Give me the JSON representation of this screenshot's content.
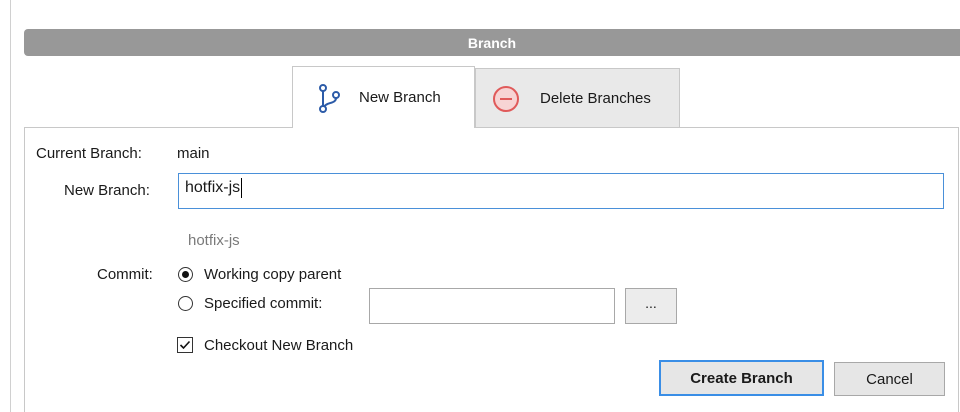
{
  "dialog": {
    "title": "Branch"
  },
  "tabs": [
    {
      "label": "New Branch",
      "icon": "branch-icon",
      "active": true
    },
    {
      "label": "Delete Branches",
      "icon": "minus-circle-icon",
      "active": false
    }
  ],
  "form": {
    "current_branch_label": "Current Branch:",
    "current_branch_value": "main",
    "new_branch_label": "New Branch:",
    "new_branch_value": "hotfix-js",
    "branch_preview": "hotfix-js",
    "commit_label": "Commit:",
    "commit_options": [
      {
        "label": "Working copy parent",
        "checked": true
      },
      {
        "label": "Specified commit:",
        "checked": false
      }
    ],
    "specified_commit_value": "",
    "browse_label": "...",
    "checkout_label": "Checkout New Branch",
    "checkout_checked": true
  },
  "buttons": {
    "create": "Create Branch",
    "cancel": "Cancel"
  },
  "colors": {
    "title_bar": "#989898",
    "focus_border": "#4a90d9",
    "delete_icon": "#e05a5a",
    "branch_icon": "#2c5ba8"
  }
}
